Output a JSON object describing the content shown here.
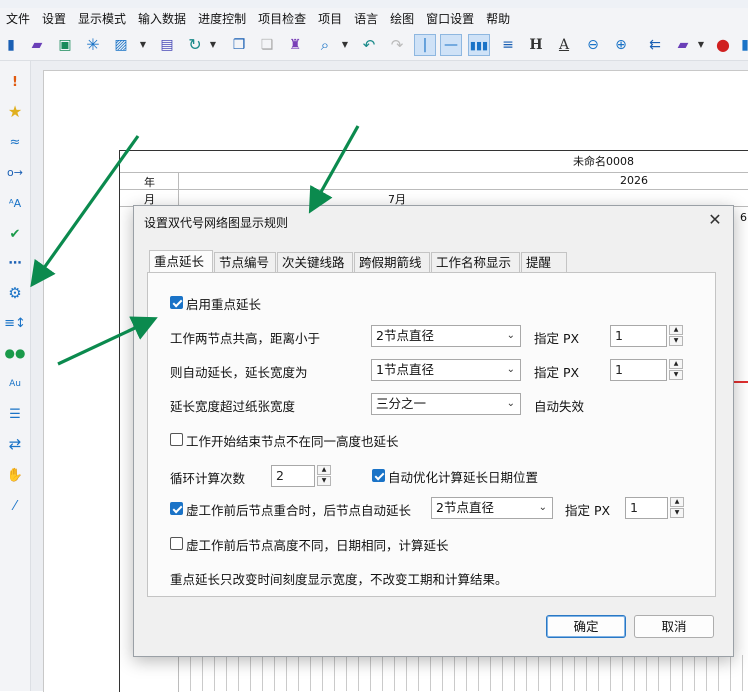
{
  "menu": [
    "文件",
    "设置",
    "显示模式",
    "输入数据",
    "进度控制",
    "项目检查",
    "项目",
    "语言",
    "绘图",
    "窗口设置",
    "帮助"
  ],
  "toolbar_icons": [
    "new-file-icon",
    "open-folder-icon",
    "save-icon",
    "asterisk-icon",
    "image-icon",
    "print-icon",
    "refresh-icon",
    "copy-icon",
    "paste-icon",
    "format-painter-icon",
    "search-icon",
    "undo-icon",
    "redo-icon",
    "vertical-line-icon",
    "horizontal-line-icon",
    "bars-icon",
    "list-icon",
    "text-h-icon",
    "text-a-icon",
    "zoom-out-icon",
    "zoom-in-icon",
    "arrow-icon",
    "folder-icon",
    "record-icon"
  ],
  "sidebar_icons": [
    "exclamation-icon",
    "star-icon",
    "wave-icon",
    "link-icon",
    "text-az-icon",
    "check-icon",
    "dots-icon",
    "gear-icon",
    "sort-icon",
    "users-icon",
    "font-au-icon",
    "filter-icon",
    "swap-icon",
    "hand-icon",
    "wand-icon"
  ],
  "colors": {
    "accent": "#1a73c7",
    "arrow": "#0b8a4e",
    "redline": "#e03030"
  },
  "sheet": {
    "doc_title": "未命名0008",
    "row_year_label": "年",
    "row_month_label": "月",
    "year": "2026",
    "month": "7月",
    "edge_label": "6"
  },
  "dialog": {
    "title": "设置双代号网络图显示规则",
    "close": "✕",
    "tabs": [
      "重点延长",
      "节点编号",
      "次关键线路",
      "跨假期箭线",
      "工作名称显示",
      "提醒"
    ],
    "selected_tab": 0,
    "enable_label": "启用重点延长",
    "enable_checked": true,
    "row1": {
      "label": "工作两节点共高，距离小于",
      "combo": "2节点直径",
      "px_label": "指定 PX",
      "px": "1"
    },
    "row2": {
      "label": "则自动延长，延长宽度为",
      "combo": "1节点直径",
      "px_label": "指定 PX",
      "px": "1"
    },
    "row3": {
      "label": "延长宽度超过纸张宽度",
      "combo": "三分之一",
      "suffix": "自动失效"
    },
    "start_end_label": "工作开始结束节点不在同一高度也延长",
    "start_end_checked": false,
    "loop_label": "循环计算次数",
    "loop_value": "2",
    "auto_opt_label": "自动优化计算延长日期位置",
    "auto_opt_checked": true,
    "virtual_label": "虚工作前后节点重合时，后节点自动延长",
    "virtual_checked": true,
    "virtual_combo": "2节点直径",
    "virtual_px_label": "指定 PX",
    "virtual_px": "1",
    "virtual_diff_label": "虚工作前后节点高度不同，日期相同，计算延长",
    "virtual_diff_checked": false,
    "note": "重点延长只改变时间刻度显示宽度，不改变工期和计算结果。",
    "ok": "确定",
    "cancel": "取消"
  }
}
